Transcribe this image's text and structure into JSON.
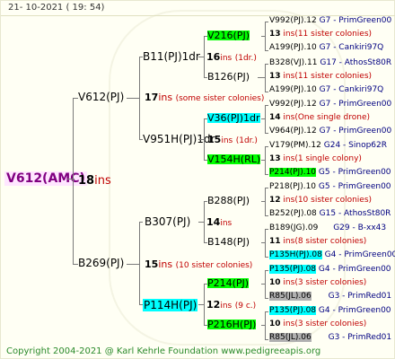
{
  "header": {
    "date": "21- 10-2021 ( 19: 54)"
  },
  "footer": {
    "copyright": "Copyright 2004-2021 @ Karl Kehrle Foundation   www.pedigreeapis.org"
  },
  "root": {
    "name": "V612(AMC)",
    "ins_num": "18",
    "ins": "ins"
  },
  "gen1": [
    {
      "name": "V612(PJ)",
      "ins_num": "17",
      "ins": "ins",
      "note": "(some sister colonies)"
    },
    {
      "name": "B269(PJ)",
      "ins_num": "15",
      "ins": "ins",
      "note": "(10 sister colonies)"
    }
  ],
  "gen2": [
    {
      "name": "B11(PJ)1dr",
      "ins_num": "16",
      "ins": "ins",
      "note": "(1dr.)"
    },
    {
      "name": "V951H(PJ)1dr",
      "ins_num": "15",
      "ins": "ins",
      "note": "(1dr.)"
    },
    {
      "name": "B307(PJ)",
      "ins_num": "14",
      "ins": "ins",
      "note": ""
    },
    {
      "name": "P114H(PJ)",
      "ins_num": "12",
      "ins": "ins",
      "note": "(9 c.)"
    }
  ],
  "gen3": [
    {
      "name": "V216(PJ)",
      "hl": "g"
    },
    {
      "name": "B126(PJ)",
      "hl": ""
    },
    {
      "name": "V36(PJ)1dr",
      "hl": "c"
    },
    {
      "name": "V154H(RL)",
      "hl": "g"
    },
    {
      "name": "B288(PJ)",
      "hl": ""
    },
    {
      "name": "B148(PJ)",
      "hl": ""
    },
    {
      "name": "P214(PJ)",
      "hl": "g"
    },
    {
      "name": "P216H(PJ)",
      "hl": "g"
    }
  ],
  "gen4": [
    {
      "l1a": "V992(PJ).12",
      "l1b": "G7 - PrimGreen00",
      "l2n": "13",
      "l2i": "ins",
      "l2t": "(11 sister colonies)",
      "l3a": "A199(PJ).10",
      "l3b": "G7 - Cankiri97Q"
    },
    {
      "l1a": "B328(VJ).11",
      "l1b": "G17 - AthosSt80R",
      "l2n": "13",
      "l2i": "ins",
      "l2t": "(11 sister colonies)",
      "l3a": "A199(PJ).10",
      "l3b": "G7 - Cankiri97Q"
    },
    {
      "l1a": "V992(PJ).12",
      "l1b": "G7 - PrimGreen00",
      "l2n": "14",
      "l2i": "ins",
      "l2t": "(One single drone)",
      "l3a": "V964(PJ).12",
      "l3b": "G7 - PrimGreen00"
    },
    {
      "l1a": "V179(PM).12",
      "l1b": "G24 - Sinop62R",
      "l2n": "13",
      "l2i": "ins",
      "l2t": "(1 single colony)",
      "l3a": "P214(PJ).10",
      "l3b": "G5 - PrimGreen00"
    },
    {
      "l1a": "P218(PJ).10",
      "l1b": "G5 - PrimGreen00",
      "l2n": "12",
      "l2i": "ins",
      "l2t": "(10 sister colonies)",
      "l3a": "B252(PJ).08",
      "l3b": "G15 - AthosSt80R"
    },
    {
      "l1a": "B189(JG).09",
      "l1b": "G29 - B-xx43",
      "l2n": "11",
      "l2i": "ins",
      "l2t": "(8 sister colonies)",
      "l3a": "P135H(PJ).08",
      "l3b": "G4 - PrimGreen00"
    },
    {
      "l1a": "P135(PJ).08",
      "l1b": "G4 - PrimGreen00",
      "l2n": "10",
      "l2i": "ins",
      "l2t": "(3 sister colonies)",
      "l3a": "R85(JL).06",
      "l3b": "G3 - PrimRed01"
    },
    {
      "l1a": "P135(PJ).08",
      "l1b": "G4 - PrimGreen00",
      "l2n": "10",
      "l2i": "ins",
      "l2t": "(3 sister colonies)",
      "l3a": "R85(JL).06",
      "l3b": "G3 - PrimRed01"
    }
  ]
}
